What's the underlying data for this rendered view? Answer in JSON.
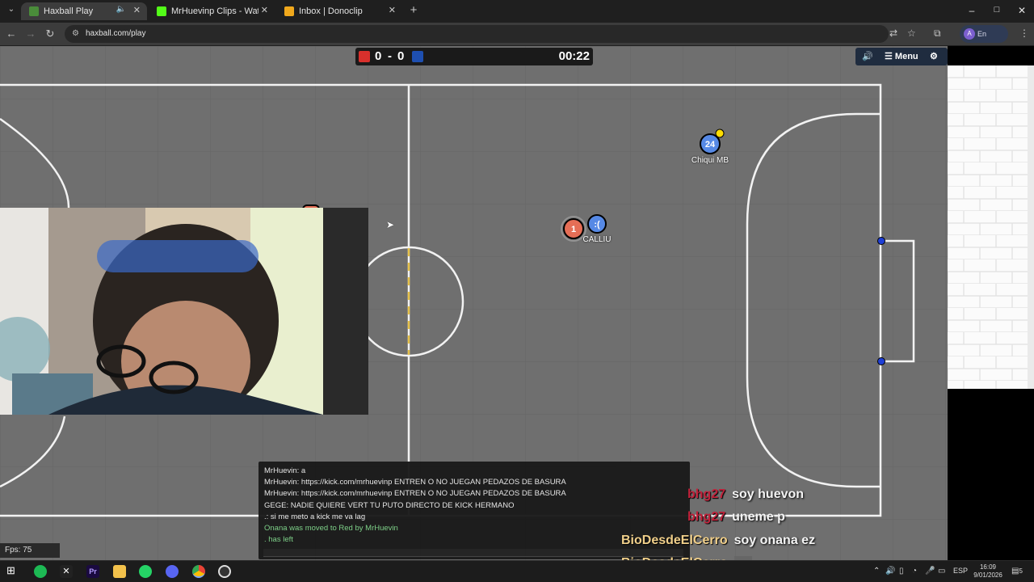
{
  "browser": {
    "tabs": [
      {
        "title": "Haxball Play",
        "favicon_color": "#4a8c3a",
        "active": true
      },
      {
        "title": "MrHuevinp Clips - Watch Live o",
        "favicon_color": "#53fc18",
        "active": false
      },
      {
        "title": "Inbox | Donoclip",
        "favicon_color": "#f0a81c",
        "active": false
      }
    ],
    "new_tab": "+",
    "url": "haxball.com/play",
    "profile_initial": "A",
    "profile_status": "En pausa",
    "window_controls": {
      "minimize": "–",
      "maximize": "□",
      "close": "✕"
    }
  },
  "game": {
    "score_red": "0",
    "score_separator": "-",
    "score_blue": "0",
    "time": "00:22",
    "menu_label": "Menu",
    "red_color": "#e56e56",
    "blue_color": "#5689e5",
    "players": [
      {
        "avatar": "24",
        "name": "Chiqui MB",
        "team": "blue"
      },
      {
        "avatar": "1",
        "name": "",
        "team": "red"
      },
      {
        "avatar": ":(",
        "name": "CALLIU",
        "team": "blue"
      }
    ]
  },
  "chat": {
    "lines": [
      {
        "text": "MrHuevin: a",
        "type": "message"
      },
      {
        "text": "MrHuevin: https://kick.com/mrhuevinp ENTREN O NO JUEGAN PEDAZOS DE BASURA",
        "type": "message"
      },
      {
        "text": "MrHuevin: https://kick.com/mrhuevinp ENTREN O NO JUEGAN PEDAZOS DE BASURA",
        "type": "message"
      },
      {
        "text": "GEGE: NADIE QUIERE VERT TU PUTO DIRECTO DE KICK HERMANO",
        "type": "message"
      },
      {
        "text": ".: si me meto a kick me va lag",
        "type": "message"
      },
      {
        "text": "Onana was moved to Red by MrHuevin",
        "type": "notice"
      },
      {
        "text": ". has left",
        "type": "notice"
      }
    ]
  },
  "stream_overlay": [
    {
      "name": "bhg27",
      "message": "soy huevon",
      "name_color": "#c0213a"
    },
    {
      "name": "bhg27",
      "message": "uneme p",
      "name_color": "#c0213a"
    },
    {
      "name": "BioDesdeElCerro",
      "message": "soy onana ez",
      "name_color": "#f0cf8a"
    },
    {
      "name": "BioDesdeElCerro",
      "message": "",
      "name_color": "#f0cf8a"
    }
  ],
  "fps": "Fps: 75",
  "taskbar": {
    "language": "ESP",
    "time": "16:09",
    "date": "9/01/2026",
    "notifications": "5"
  }
}
